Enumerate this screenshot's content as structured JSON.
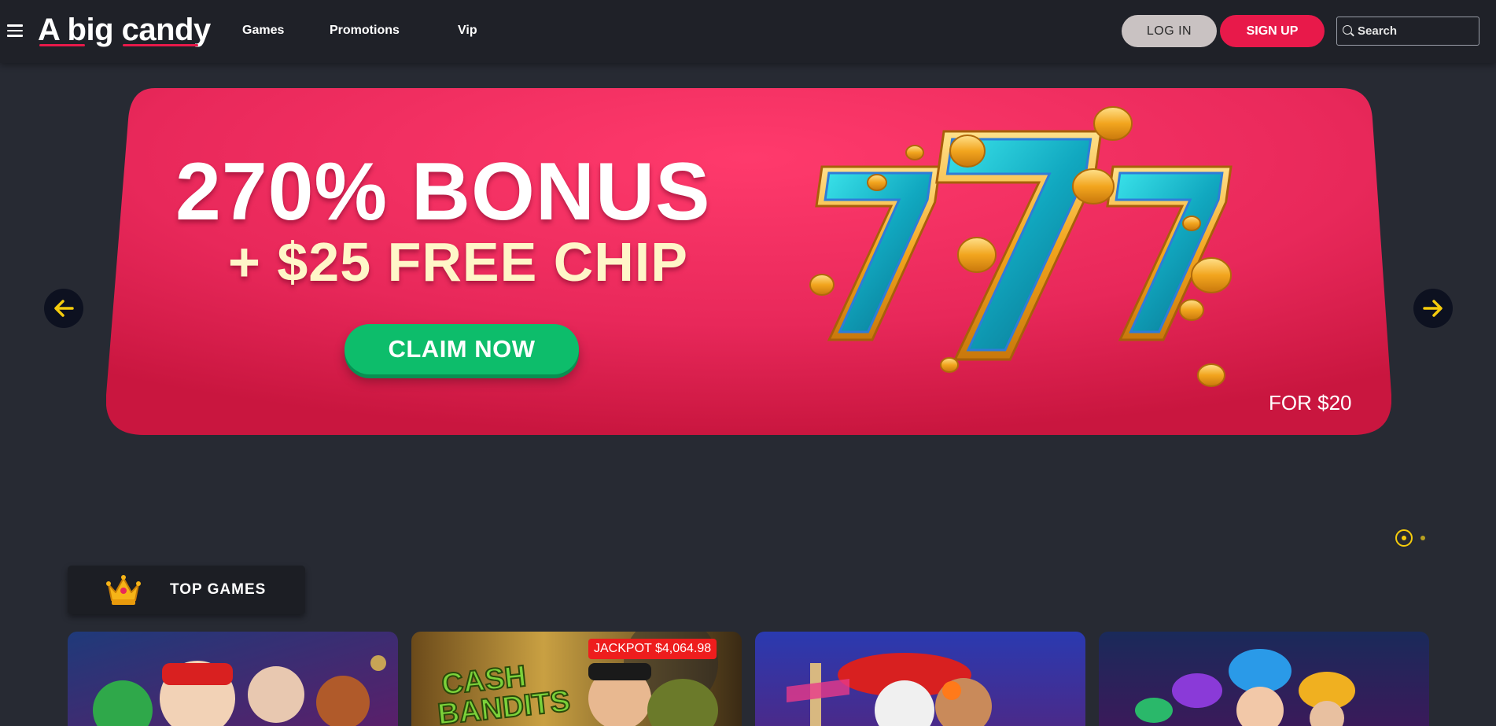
{
  "header": {
    "menu_icon": "hamburger-menu-icon",
    "logo_text": "A big candy",
    "nav": [
      "Games",
      "Promotions",
      "Vip"
    ],
    "login_label": "LOG IN",
    "signup_label": "SIGN UP",
    "search_placeholder": "Search",
    "search_icon": "search-icon"
  },
  "banner": {
    "headline": "270% BONUS",
    "subline": "+ $25 FREE CHIP",
    "cta_label": "CLAIM NOW",
    "fine_print": "FOR $20",
    "artwork": "triple-seven-slot-with-coins",
    "colors": {
      "background": "#e8285a",
      "cta": "#0dbd6b",
      "headline": "#ffffff",
      "subline": "#fff6c8"
    }
  },
  "carousel": {
    "prev_icon": "arrow-left-icon",
    "next_icon": "arrow-right-icon",
    "slide_count": 2,
    "active_slide": 1,
    "accent": "#f5cc0c"
  },
  "top_games": {
    "title": "TOP GAMES",
    "icon": "crown-icon",
    "games": [
      {
        "name": "holiday-slot-game",
        "jackpot": ""
      },
      {
        "name": "cash-bandits-slot-game",
        "artwork_text": "CASH BANDITS",
        "jackpot": "JACKPOT $4,064.98"
      },
      {
        "name": "day-of-the-dead-slot-game",
        "jackpot": ""
      },
      {
        "name": "mushroom-forest-slot-game",
        "jackpot": ""
      }
    ]
  }
}
